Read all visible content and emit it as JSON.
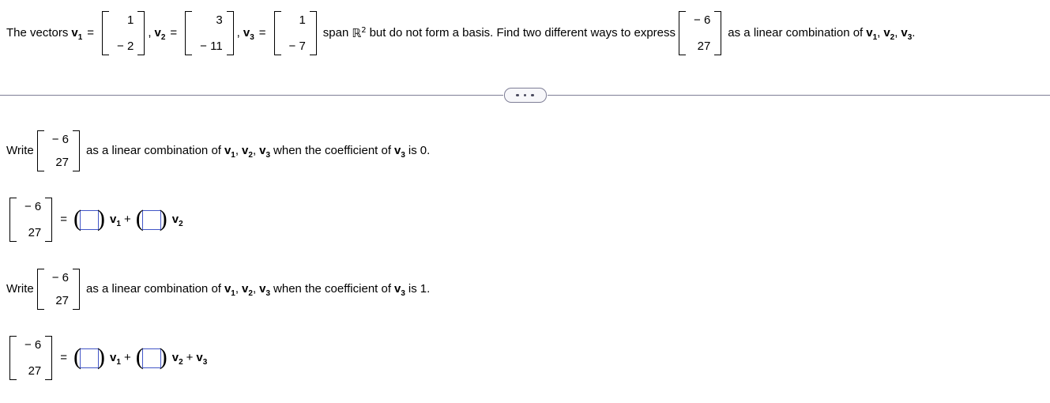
{
  "problem": {
    "lead_text": "The vectors",
    "v1_label": "v",
    "v1_sub": "1",
    "eq_sign": "=",
    "v1_vector": [
      "1",
      "− 2"
    ],
    "comma": ",",
    "v2_label": "v",
    "v2_sub": "2",
    "v2_vector": [
      "3",
      "− 11"
    ],
    "v3_label": "v",
    "v3_sub": "3",
    "v3_vector": [
      "1",
      "− 7"
    ],
    "span_text": "span",
    "field_symbol": "ℝ",
    "field_exponent": "2",
    "middle_text": "but do not form a basis. Find two different ways to express",
    "target_vector": [
      "− 6",
      "27"
    ],
    "tail_text": "as a linear combination of",
    "tail_v1": "v",
    "tail_v1_sub": "1",
    "tail_comma1": ",",
    "tail_v2": "v",
    "tail_v2_sub": "2",
    "tail_comma2": ",",
    "tail_v3": "v",
    "tail_v3_sub": "3",
    "period": "."
  },
  "divider": {
    "more_button_name": "ellipsis-button",
    "dot_count": 3,
    "line_color": "#7e7e96",
    "button_fill": "#f7f7fa"
  },
  "parts": [
    {
      "prompt_lead": "Write",
      "prompt_vector": [
        "− 6",
        "27"
      ],
      "prompt_mid": "as a linear combination of",
      "prompt_v1": "v",
      "prompt_v1_sub": "1",
      "prompt_comma1": ",",
      "prompt_v2": "v",
      "prompt_v2_sub": "2",
      "prompt_comma2": ",",
      "prompt_v3": "v",
      "prompt_v3_sub": "3",
      "prompt_tail": "when the coefficient of",
      "prompt_coef_v": "v",
      "prompt_coef_sub": "3",
      "prompt_is": "is",
      "prompt_value": "0.",
      "answer_vector": [
        "− 6",
        "27"
      ],
      "equals": "=",
      "blank1_value": "",
      "blank1_placeholder": "",
      "term1_v": "v",
      "term1_sub": "1",
      "plus1": "+",
      "blank2_value": "",
      "blank2_placeholder": "",
      "term2_v": "v",
      "term2_sub": "2",
      "has_third_term": false,
      "plus2": "",
      "term3_v": "",
      "term3_sub": ""
    },
    {
      "prompt_lead": "Write",
      "prompt_vector": [
        "− 6",
        "27"
      ],
      "prompt_mid": "as a linear combination of",
      "prompt_v1": "v",
      "prompt_v1_sub": "1",
      "prompt_comma1": ",",
      "prompt_v2": "v",
      "prompt_v2_sub": "2",
      "prompt_comma2": ",",
      "prompt_v3": "v",
      "prompt_v3_sub": "3",
      "prompt_tail": "when the coefficient of",
      "prompt_coef_v": "v",
      "prompt_coef_sub": "3",
      "prompt_is": "is",
      "prompt_value": "1.",
      "answer_vector": [
        "− 6",
        "27"
      ],
      "equals": "=",
      "blank1_value": "",
      "blank1_placeholder": "",
      "term1_v": "v",
      "term1_sub": "1",
      "plus1": "+",
      "blank2_value": "",
      "blank2_placeholder": "",
      "term2_v": "v",
      "term2_sub": "2",
      "has_third_term": true,
      "plus2": "+",
      "term3_v": "v",
      "term3_sub": "3"
    }
  ],
  "colors": {
    "input_border": "#4256c7",
    "text": "#000000",
    "background": "#ffffff",
    "divider": "#7e7e96"
  }
}
